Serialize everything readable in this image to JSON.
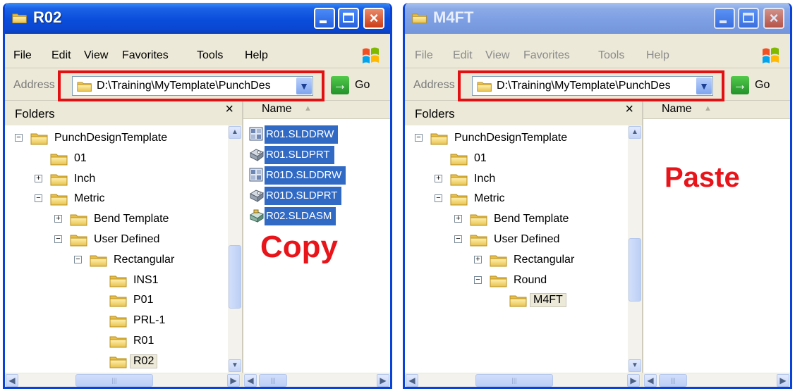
{
  "colors": {
    "titlebar_active": "#0a4ddb",
    "titlebar_inactive": "#7c9ee2",
    "highlight_box": "#e21012",
    "selection": "#316ac5",
    "big_label": "#e8141a"
  },
  "menu_labels": [
    "File",
    "Edit",
    "View",
    "Favorites",
    "Tools",
    "Help"
  ],
  "left_window": {
    "title": "R02",
    "address_label": "Address",
    "address_value": "D:\\Training\\MyTemplate\\PunchDes",
    "go_label": "Go",
    "folders_title": "Folders",
    "pane_close": "×",
    "name_column": "Name",
    "tree": [
      {
        "label": "PunchDesignTemplate",
        "expander": "−",
        "depth": 0
      },
      {
        "label": "01",
        "expander": "",
        "depth": 1
      },
      {
        "label": "Inch",
        "expander": "+",
        "depth": 1
      },
      {
        "label": "Metric",
        "expander": "−",
        "depth": 1
      },
      {
        "label": "Bend Template",
        "expander": "+",
        "depth": 2
      },
      {
        "label": "User Defined",
        "expander": "−",
        "depth": 2
      },
      {
        "label": "Rectangular",
        "expander": "−",
        "depth": 3
      },
      {
        "label": "INS1",
        "expander": "",
        "depth": 4
      },
      {
        "label": "P01",
        "expander": "",
        "depth": 4
      },
      {
        "label": "PRL-1",
        "expander": "",
        "depth": 4
      },
      {
        "label": "R01",
        "expander": "",
        "depth": 4
      },
      {
        "label": "R02",
        "expander": "",
        "depth": 4,
        "selected": true
      }
    ],
    "files": [
      {
        "name": "R01.SLDDRW",
        "icon": "drawing-file-icon"
      },
      {
        "name": "R01.SLDPRT",
        "icon": "part-file-icon"
      },
      {
        "name": "R01D.SLDDRW",
        "icon": "drawing-file-icon"
      },
      {
        "name": "R01D.SLDPRT",
        "icon": "part-file-icon"
      },
      {
        "name": "R02.SLDASM",
        "icon": "assembly-file-icon"
      }
    ],
    "annotation": "Copy"
  },
  "right_window": {
    "title": "M4FT",
    "address_label": "Address",
    "address_value": "D:\\Training\\MyTemplate\\PunchDes",
    "go_label": "Go",
    "folders_title": "Folders",
    "pane_close": "×",
    "name_column": "Name",
    "tree": [
      {
        "label": "PunchDesignTemplate",
        "expander": "−",
        "depth": 0
      },
      {
        "label": "01",
        "expander": "",
        "depth": 1
      },
      {
        "label": "Inch",
        "expander": "+",
        "depth": 1
      },
      {
        "label": "Metric",
        "expander": "−",
        "depth": 1
      },
      {
        "label": "Bend Template",
        "expander": "+",
        "depth": 2
      },
      {
        "label": "User Defined",
        "expander": "−",
        "depth": 2
      },
      {
        "label": "Rectangular",
        "expander": "+",
        "depth": 3
      },
      {
        "label": "Round",
        "expander": "−",
        "depth": 3
      },
      {
        "label": "M4FT",
        "expander": "",
        "depth": 4,
        "selected": true
      }
    ],
    "files": [],
    "annotation": "Paste"
  }
}
